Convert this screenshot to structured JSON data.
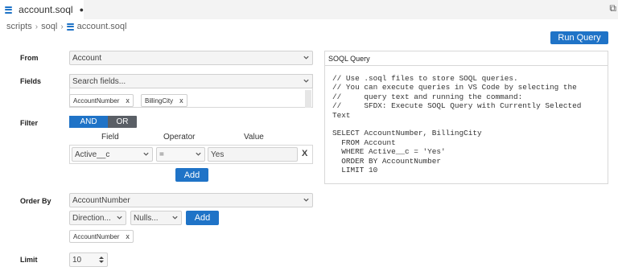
{
  "tab": {
    "title": "account.soql",
    "modified": "●"
  },
  "breadcrumb": {
    "items": [
      "scripts",
      "soql"
    ],
    "file": "account.soql"
  },
  "toolbar": {
    "run_label": "Run Query"
  },
  "from": {
    "label": "From",
    "value": "Account"
  },
  "fields": {
    "label": "Fields",
    "placeholder": "Search fields...",
    "selected": [
      "AccountNumber",
      "BillingCity"
    ]
  },
  "filter": {
    "label": "Filter",
    "and_label": "AND",
    "or_label": "OR",
    "headers": {
      "field": "Field",
      "operator": "Operator",
      "value": "Value"
    },
    "row": {
      "field": "Active__c",
      "operator": "=",
      "value": "Yes",
      "remove": "X"
    },
    "add_label": "Add"
  },
  "order_by": {
    "label": "Order By",
    "value": "AccountNumber",
    "direction": "Direction...",
    "nulls": "Nulls...",
    "add_label": "Add",
    "selected": [
      "AccountNumber"
    ]
  },
  "limit": {
    "label": "Limit",
    "value": "10"
  },
  "soql_panel": {
    "title": "SOQL Query",
    "lines": [
      "// Use .soql files to store SOQL queries.",
      "// You can execute queries in VS Code by selecting the",
      "//     query text and running the command:",
      "//     SFDX: Execute SOQL Query with Currently Selected",
      "Text",
      "",
      "SELECT AccountNumber, BillingCity",
      "  FROM Account",
      "  WHERE Active__c = 'Yes'",
      "  ORDER BY AccountNumber",
      "  LIMIT 10"
    ]
  },
  "colors": {
    "accent": "#1f73c7",
    "toggle_off": "#5a5f66"
  }
}
